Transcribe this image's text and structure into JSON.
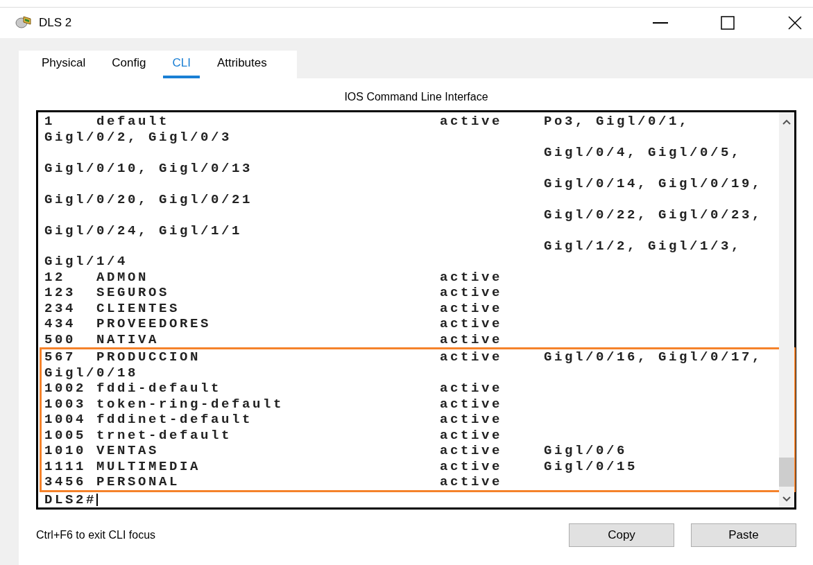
{
  "window": {
    "title": "DLS 2"
  },
  "tabs": [
    {
      "label": "Physical",
      "selected": false
    },
    {
      "label": "Config",
      "selected": false
    },
    {
      "label": "CLI",
      "selected": true
    },
    {
      "label": "Attributes",
      "selected": false
    }
  ],
  "cli": {
    "heading": "IOS Command Line Interface",
    "lines": [
      {
        "kind": "vlan",
        "id": "1",
        "name": "default",
        "status": "active",
        "ports": "Po3, Gigl/0/1,"
      },
      {
        "kind": "wrap",
        "text": "Gigl/0/2, Gigl/0/3"
      },
      {
        "kind": "ports",
        "text": "Gigl/0/4, Gigl/0/5,"
      },
      {
        "kind": "wrap",
        "text": "Gigl/0/10, Gigl/0/13"
      },
      {
        "kind": "ports",
        "text": "Gigl/0/14, Gigl/0/19,"
      },
      {
        "kind": "wrap",
        "text": "Gigl/0/20, Gigl/0/21"
      },
      {
        "kind": "ports",
        "text": "Gigl/0/22, Gigl/0/23,"
      },
      {
        "kind": "wrap",
        "text": "Gigl/0/24, Gigl/1/1"
      },
      {
        "kind": "ports",
        "text": "Gigl/1/2, Gigl/1/3,"
      },
      {
        "kind": "wrap",
        "text": "Gigl/1/4"
      },
      {
        "kind": "vlan",
        "id": "12",
        "name": "ADMON",
        "status": "active"
      },
      {
        "kind": "vlan",
        "id": "123",
        "name": "SEGUROS",
        "status": "active"
      },
      {
        "kind": "vlan",
        "id": "234",
        "name": "CLIENTES",
        "status": "active"
      },
      {
        "kind": "vlan",
        "id": "434",
        "name": "PROVEEDORES",
        "status": "active"
      },
      {
        "kind": "vlan",
        "id": "500",
        "name": "NATIVA",
        "status": "active"
      }
    ],
    "highlighted_lines": [
      {
        "kind": "vlan",
        "id": "567",
        "name": "PRODUCCION",
        "status": "active",
        "ports": "Gigl/0/16, Gigl/0/17,"
      },
      {
        "kind": "wrap",
        "text": "Gigl/0/18"
      },
      {
        "kind": "vlan",
        "id": "1002",
        "name": "fddi-default",
        "status": "active"
      },
      {
        "kind": "vlan",
        "id": "1003",
        "name": "token-ring-default",
        "status": "active"
      },
      {
        "kind": "vlan",
        "id": "1004",
        "name": "fddinet-default",
        "status": "active"
      },
      {
        "kind": "vlan",
        "id": "1005",
        "name": "trnet-default",
        "status": "active"
      },
      {
        "kind": "vlan",
        "id": "1010",
        "name": "VENTAS",
        "status": "active",
        "ports": "Gigl/0/6"
      },
      {
        "kind": "vlan",
        "id": "1111",
        "name": "MULTIMEDIA",
        "status": "active",
        "ports": "Gigl/0/15"
      },
      {
        "kind": "vlan",
        "id": "3456",
        "name": "PERSONAL",
        "status": "active"
      }
    ],
    "prompt": "DLS2#"
  },
  "footer": {
    "hint": "Ctrl+F6 to exit CLI focus",
    "buttons": [
      "Copy",
      "Paste"
    ]
  }
}
